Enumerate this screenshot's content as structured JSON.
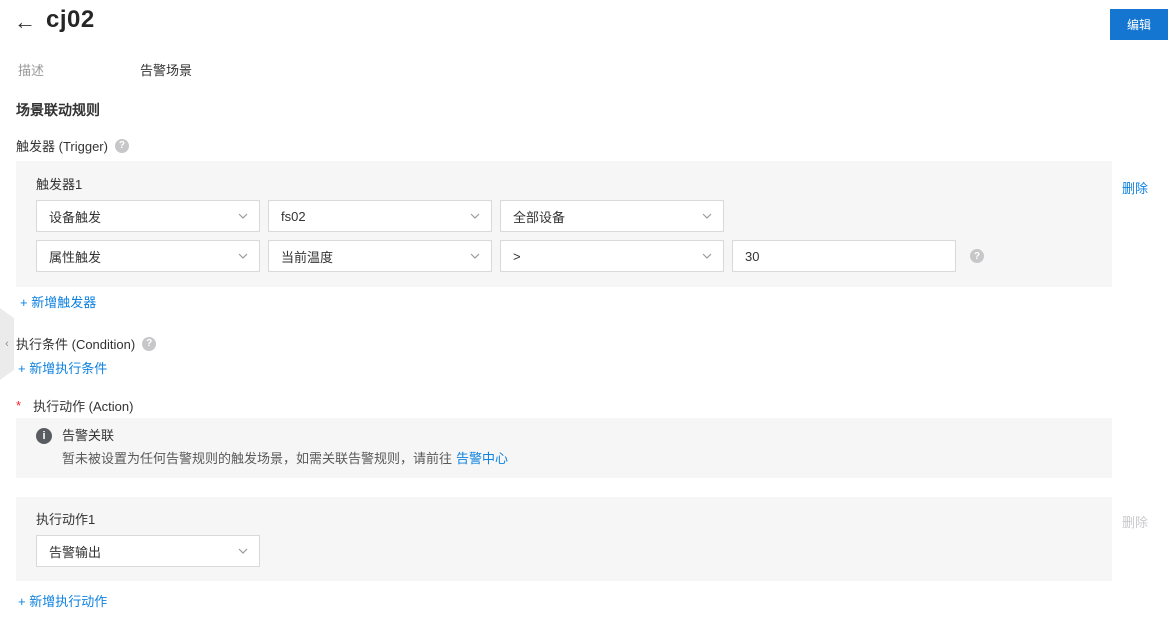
{
  "header": {
    "back_icon": "←",
    "title": "cj02",
    "edit_button": "编辑"
  },
  "description": {
    "label": "描述",
    "value": "告警场景"
  },
  "rule": {
    "section_title": "场景联动规则",
    "trigger": {
      "label": "触发器 (Trigger)",
      "help_icon": "?",
      "card_title": "触发器1",
      "delete_link": "删除",
      "selects_row1": [
        "设备触发",
        "fs02",
        "全部设备"
      ],
      "selects_row2": [
        "属性触发",
        "当前温度",
        ">"
      ],
      "value_input": "30",
      "input_help_icon": "?",
      "add_link": "+ 新增触发器"
    },
    "condition": {
      "label": "执行条件 (Condition)",
      "help_icon": "?",
      "add_link": "+ 新增执行条件"
    },
    "action": {
      "required_mark": "*",
      "label": "执行动作 (Action)",
      "notice": {
        "info_icon": "i",
        "title": "告警关联",
        "text": "暂未被设置为任何告警规则的触发场景，如需关联告警规则，请前往",
        "link": "告警中心"
      },
      "card_title": "执行动作1",
      "select_value": "告警输出",
      "delete_link": "删除",
      "add_link": "+ 新增执行动作"
    }
  },
  "colors": {
    "primary_button": "#1476d0",
    "link": "#0e82e0",
    "panel_bg": "#f6f6f6",
    "input_border": "#d9d9d9",
    "text": "#333333",
    "muted": "#999999",
    "disabled": "#c9c9cd",
    "required": "#f5222d"
  }
}
